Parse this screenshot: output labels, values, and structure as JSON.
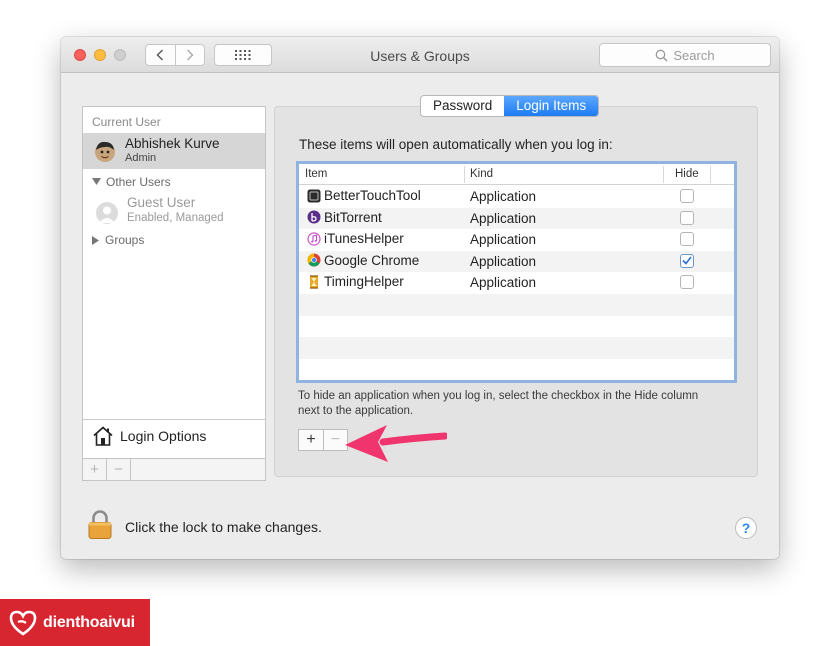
{
  "window": {
    "title": "Users & Groups",
    "search_placeholder": "Search"
  },
  "sidebar": {
    "current_user_header": "Current User",
    "current_user": {
      "name": "Abhishek Kurve",
      "role": "Admin"
    },
    "other_users_header": "Other Users",
    "guest": {
      "name": "Guest User",
      "status": "Enabled, Managed"
    },
    "groups_header": "Groups",
    "login_options": "Login Options",
    "add_symbol": "+",
    "remove_symbol": "−"
  },
  "tabs": [
    {
      "label": "Password",
      "active": false
    },
    {
      "label": "Login Items",
      "active": true
    }
  ],
  "login_items": {
    "intro": "These items will open automatically when you log in:",
    "columns": {
      "item": "Item",
      "kind": "Kind",
      "hide": "Hide"
    },
    "rows": [
      {
        "name": "BetterTouchTool",
        "kind": "Application",
        "hide": false,
        "icon": "bettertouchtool-icon"
      },
      {
        "name": "BitTorrent",
        "kind": "Application",
        "hide": false,
        "icon": "bittorrent-icon"
      },
      {
        "name": "iTunesHelper",
        "kind": "Application",
        "hide": false,
        "icon": "itunes-icon"
      },
      {
        "name": "Google Chrome",
        "kind": "Application",
        "hide": true,
        "icon": "chrome-icon"
      },
      {
        "name": "TimingHelper",
        "kind": "Application",
        "hide": false,
        "icon": "timing-icon"
      }
    ],
    "hint": "To hide an application when you log in, select the checkbox in the Hide column next to the application.",
    "add_symbol": "+",
    "remove_symbol": "−"
  },
  "footer": {
    "lock_text": "Click the lock to make changes.",
    "help_symbol": "?"
  },
  "watermark": {
    "text": "dienthoaivui"
  },
  "colors": {
    "accent_blue": "#1d7cf2",
    "annotation_arrow": "#f0356e",
    "brand_red": "#d7262f"
  }
}
